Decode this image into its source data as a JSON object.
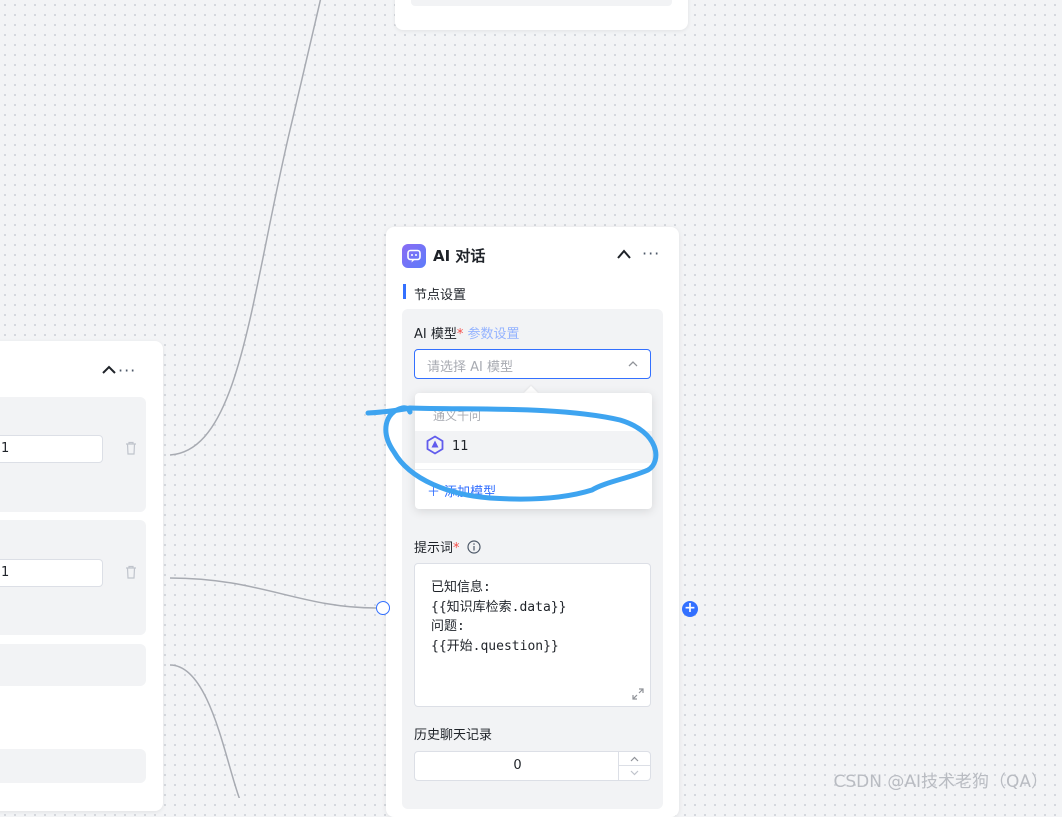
{
  "colors": {
    "accent": "#3370ff",
    "required": "#f54a45",
    "link": "#94b3ff",
    "annotation": "#3ea4f0"
  },
  "left_node": {
    "inputs": [
      "1",
      "1"
    ]
  },
  "ai_node": {
    "title": "AI 对话",
    "section_title": "节点设置",
    "model": {
      "label": "AI 模型",
      "required_mark": "*",
      "params_link": "参数设置",
      "placeholder": "请选择 AI 模型"
    },
    "dropdown": {
      "group_label": "通义千问",
      "items": [
        {
          "label": "11",
          "icon": "qwen-model-icon"
        }
      ],
      "add_label": "添加模型"
    },
    "prompt": {
      "label": "提示词",
      "required_mark": "*",
      "value": "已知信息:\n{{知识库检索.data}}\n问题:\n{{开始.question}}"
    },
    "history": {
      "label": "历史聊天记录",
      "value": "0"
    }
  },
  "watermark": "CSDN @AI技术老狗（QA）"
}
